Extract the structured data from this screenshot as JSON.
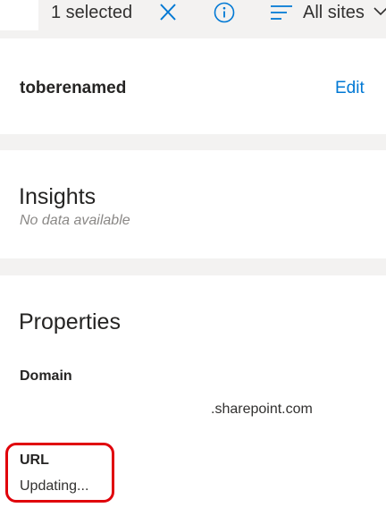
{
  "toolbar": {
    "selected_label": "1 selected",
    "close_icon": "close-icon",
    "info_icon": "info-icon",
    "filter_icon": "filter-icon",
    "sites_label": "All sites",
    "chevron_icon": "chevron-down-icon"
  },
  "site": {
    "name": "toberenamed",
    "edit_label": "Edit"
  },
  "insights": {
    "title": "Insights",
    "empty_text": "No data available"
  },
  "properties": {
    "title": "Properties",
    "domain_label": "Domain",
    "domain_value": ".sharepoint.com",
    "url_label": "URL",
    "url_value": "Updating..."
  },
  "colors": {
    "accent": "#0078d4",
    "annotation": "#e0000a",
    "separator": "#f3f2f1"
  }
}
